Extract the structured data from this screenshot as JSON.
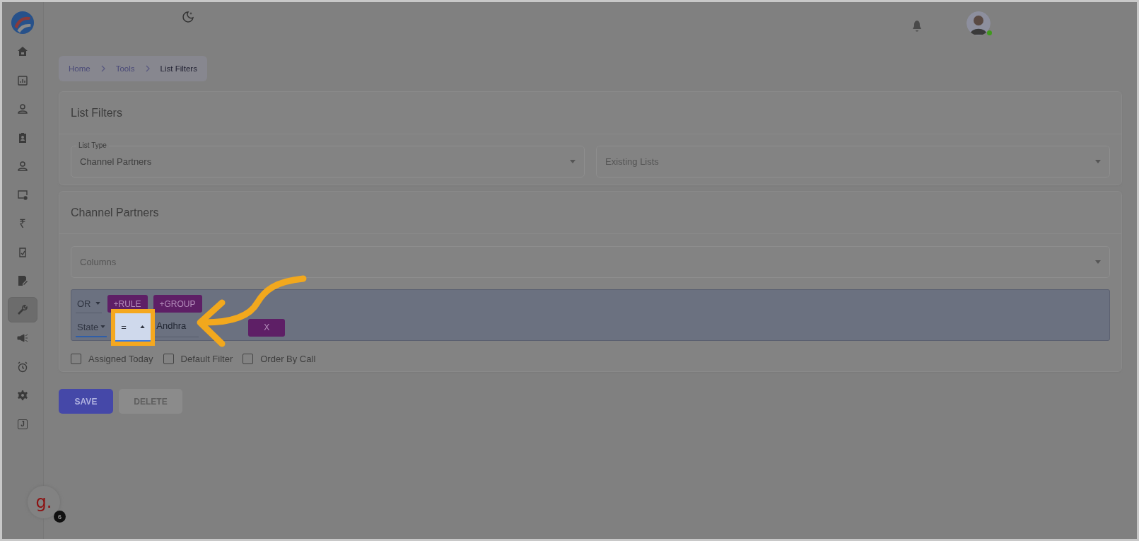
{
  "sidebar": {
    "items": [
      {
        "kind": "home",
        "selected": false
      },
      {
        "kind": "chart",
        "selected": false
      },
      {
        "kind": "person",
        "selected": false
      },
      {
        "kind": "badge",
        "selected": false
      },
      {
        "kind": "person",
        "selected": false
      },
      {
        "kind": "monitor",
        "selected": false
      },
      {
        "kind": "glyph",
        "glyph": "₹",
        "selected": false
      },
      {
        "kind": "clipboard",
        "selected": false
      },
      {
        "kind": "edit",
        "selected": false
      },
      {
        "kind": "wrench",
        "selected": true
      },
      {
        "kind": "megaphone",
        "selected": false
      },
      {
        "kind": "alarm",
        "selected": false
      },
      {
        "kind": "gear",
        "selected": false
      },
      {
        "kind": "boxed",
        "glyph": "J",
        "selected": false
      }
    ]
  },
  "top_bar": {
    "user": {
      "online": true
    }
  },
  "breadcrumb": [
    {
      "label": "Home",
      "current": false
    },
    {
      "label": "Tools",
      "current": false
    },
    {
      "label": "List Filters",
      "current": true
    }
  ],
  "list_filters": {
    "title": "List Filters",
    "list_type": {
      "label": "List Type",
      "value": "Channel Partners"
    },
    "existing_lists": {
      "placeholder": "Existing Lists"
    }
  },
  "channel_partners": {
    "title": "Channel Partners",
    "columns": {
      "placeholder": "Columns"
    },
    "query": {
      "combinator": "OR",
      "add_rule": "+RULE",
      "add_group": "+GROUP",
      "rule": {
        "field": "State",
        "operator": "=",
        "operator_focused": true,
        "value": "Andhra",
        "remove": "X"
      }
    },
    "checkboxes": [
      {
        "label": "Assigned Today",
        "checked": false
      },
      {
        "label": "Default Filter",
        "checked": false
      },
      {
        "label": "Order By Call",
        "checked": false
      }
    ]
  },
  "buttons": [
    {
      "label": "SAVE",
      "disabled": false
    },
    {
      "label": "DELETE",
      "disabled": true
    }
  ],
  "chat_widget": {
    "letter": "g.",
    "badge": "6"
  },
  "callout": {
    "shown": true
  }
}
